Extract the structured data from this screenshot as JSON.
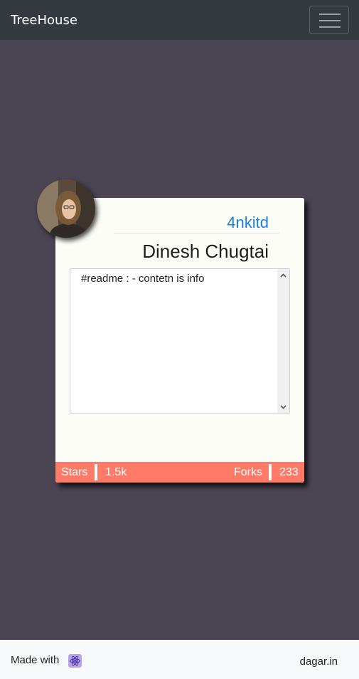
{
  "navbar": {
    "brand": "TreeHouse",
    "menu_icon": "hamburger-menu-icon"
  },
  "profile": {
    "username": "4nkitd",
    "full_name": "Dinesh Chugtai",
    "avatar_icon": "avatar-photo",
    "readme": "#readme : - contetn is info"
  },
  "stats": {
    "stars_label": "Stars",
    "stars_value": "1.5k",
    "forks_label": "Forks",
    "forks_value": "233",
    "bar_color": "#ff7b68"
  },
  "footer": {
    "made_with": "Made with",
    "made_with_icon": "react-atom-icon",
    "link": "dagar.in"
  },
  "colors": {
    "background": "#4a4453",
    "navbar": "#343a40",
    "username": "#1a7fe0"
  }
}
